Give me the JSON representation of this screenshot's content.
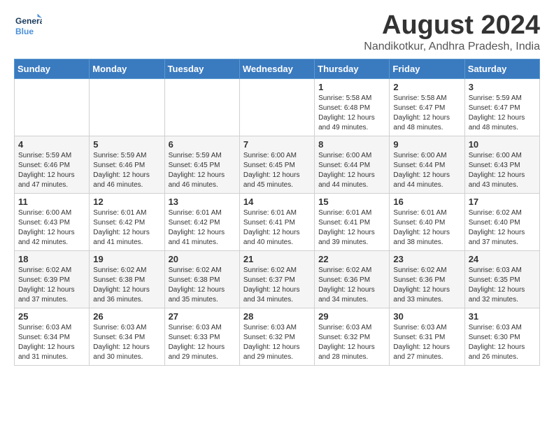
{
  "header": {
    "logo_line1": "General",
    "logo_line2": "Blue",
    "month_title": "August 2024",
    "location": "Nandikotkur, Andhra Pradesh, India"
  },
  "days_of_week": [
    "Sunday",
    "Monday",
    "Tuesday",
    "Wednesday",
    "Thursday",
    "Friday",
    "Saturday"
  ],
  "weeks": [
    [
      {
        "num": "",
        "info": ""
      },
      {
        "num": "",
        "info": ""
      },
      {
        "num": "",
        "info": ""
      },
      {
        "num": "",
        "info": ""
      },
      {
        "num": "1",
        "info": "Sunrise: 5:58 AM\nSunset: 6:48 PM\nDaylight: 12 hours\nand 49 minutes."
      },
      {
        "num": "2",
        "info": "Sunrise: 5:58 AM\nSunset: 6:47 PM\nDaylight: 12 hours\nand 48 minutes."
      },
      {
        "num": "3",
        "info": "Sunrise: 5:59 AM\nSunset: 6:47 PM\nDaylight: 12 hours\nand 48 minutes."
      }
    ],
    [
      {
        "num": "4",
        "info": "Sunrise: 5:59 AM\nSunset: 6:46 PM\nDaylight: 12 hours\nand 47 minutes."
      },
      {
        "num": "5",
        "info": "Sunrise: 5:59 AM\nSunset: 6:46 PM\nDaylight: 12 hours\nand 46 minutes."
      },
      {
        "num": "6",
        "info": "Sunrise: 5:59 AM\nSunset: 6:45 PM\nDaylight: 12 hours\nand 46 minutes."
      },
      {
        "num": "7",
        "info": "Sunrise: 6:00 AM\nSunset: 6:45 PM\nDaylight: 12 hours\nand 45 minutes."
      },
      {
        "num": "8",
        "info": "Sunrise: 6:00 AM\nSunset: 6:44 PM\nDaylight: 12 hours\nand 44 minutes."
      },
      {
        "num": "9",
        "info": "Sunrise: 6:00 AM\nSunset: 6:44 PM\nDaylight: 12 hours\nand 44 minutes."
      },
      {
        "num": "10",
        "info": "Sunrise: 6:00 AM\nSunset: 6:43 PM\nDaylight: 12 hours\nand 43 minutes."
      }
    ],
    [
      {
        "num": "11",
        "info": "Sunrise: 6:00 AM\nSunset: 6:43 PM\nDaylight: 12 hours\nand 42 minutes."
      },
      {
        "num": "12",
        "info": "Sunrise: 6:01 AM\nSunset: 6:42 PM\nDaylight: 12 hours\nand 41 minutes."
      },
      {
        "num": "13",
        "info": "Sunrise: 6:01 AM\nSunset: 6:42 PM\nDaylight: 12 hours\nand 41 minutes."
      },
      {
        "num": "14",
        "info": "Sunrise: 6:01 AM\nSunset: 6:41 PM\nDaylight: 12 hours\nand 40 minutes."
      },
      {
        "num": "15",
        "info": "Sunrise: 6:01 AM\nSunset: 6:41 PM\nDaylight: 12 hours\nand 39 minutes."
      },
      {
        "num": "16",
        "info": "Sunrise: 6:01 AM\nSunset: 6:40 PM\nDaylight: 12 hours\nand 38 minutes."
      },
      {
        "num": "17",
        "info": "Sunrise: 6:02 AM\nSunset: 6:40 PM\nDaylight: 12 hours\nand 37 minutes."
      }
    ],
    [
      {
        "num": "18",
        "info": "Sunrise: 6:02 AM\nSunset: 6:39 PM\nDaylight: 12 hours\nand 37 minutes."
      },
      {
        "num": "19",
        "info": "Sunrise: 6:02 AM\nSunset: 6:38 PM\nDaylight: 12 hours\nand 36 minutes."
      },
      {
        "num": "20",
        "info": "Sunrise: 6:02 AM\nSunset: 6:38 PM\nDaylight: 12 hours\nand 35 minutes."
      },
      {
        "num": "21",
        "info": "Sunrise: 6:02 AM\nSunset: 6:37 PM\nDaylight: 12 hours\nand 34 minutes."
      },
      {
        "num": "22",
        "info": "Sunrise: 6:02 AM\nSunset: 6:36 PM\nDaylight: 12 hours\nand 34 minutes."
      },
      {
        "num": "23",
        "info": "Sunrise: 6:02 AM\nSunset: 6:36 PM\nDaylight: 12 hours\nand 33 minutes."
      },
      {
        "num": "24",
        "info": "Sunrise: 6:03 AM\nSunset: 6:35 PM\nDaylight: 12 hours\nand 32 minutes."
      }
    ],
    [
      {
        "num": "25",
        "info": "Sunrise: 6:03 AM\nSunset: 6:34 PM\nDaylight: 12 hours\nand 31 minutes."
      },
      {
        "num": "26",
        "info": "Sunrise: 6:03 AM\nSunset: 6:34 PM\nDaylight: 12 hours\nand 30 minutes."
      },
      {
        "num": "27",
        "info": "Sunrise: 6:03 AM\nSunset: 6:33 PM\nDaylight: 12 hours\nand 29 minutes."
      },
      {
        "num": "28",
        "info": "Sunrise: 6:03 AM\nSunset: 6:32 PM\nDaylight: 12 hours\nand 29 minutes."
      },
      {
        "num": "29",
        "info": "Sunrise: 6:03 AM\nSunset: 6:32 PM\nDaylight: 12 hours\nand 28 minutes."
      },
      {
        "num": "30",
        "info": "Sunrise: 6:03 AM\nSunset: 6:31 PM\nDaylight: 12 hours\nand 27 minutes."
      },
      {
        "num": "31",
        "info": "Sunrise: 6:03 AM\nSunset: 6:30 PM\nDaylight: 12 hours\nand 26 minutes."
      }
    ]
  ]
}
